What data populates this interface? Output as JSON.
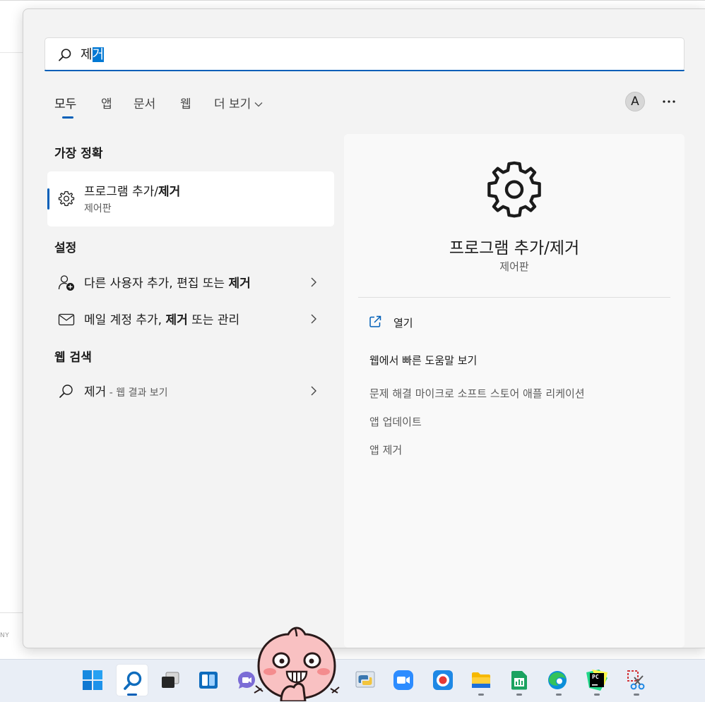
{
  "search": {
    "query_plain": "제",
    "query_selected": "거"
  },
  "tabs": [
    {
      "label": "모두",
      "active": true
    },
    {
      "label": "앱"
    },
    {
      "label": "문서"
    },
    {
      "label": "웹"
    },
    {
      "label": "더 보기"
    }
  ],
  "account": {
    "avatar_letter": "A"
  },
  "more_button_icon": "ellipsis-icon",
  "best_match": {
    "section_title": "가장 정확",
    "title_plain": "프로그램 추가/",
    "title_bold": "제거",
    "subtitle": "제어판",
    "icon": "gear-icon"
  },
  "settings": {
    "section_title": "설정",
    "items": [
      {
        "text_plain": "다른 사용자 추가, 편집 또는 ",
        "text_bold": "제거",
        "text_after": "",
        "icon": "add-user-icon"
      },
      {
        "text_plain": "메일 계정 추가, ",
        "text_bold": "제거",
        "text_after": " 또는 관리",
        "icon": "mail-icon"
      }
    ]
  },
  "web_search": {
    "section_title": "웹 검색",
    "query": "제거",
    "suffix": " - 웹 결과 보기",
    "icon": "search-icon"
  },
  "detail": {
    "title": "프로그램 추가/제거",
    "subtitle": "제어판",
    "open_label": "열기",
    "help_title": "웹에서 빠른 도움말 보기",
    "help_links": [
      "문제 해결 마이크로 소프트 스토어 애플 리케이션",
      "앱 업데이트",
      "앱 제거"
    ]
  },
  "background": {
    "corner_text": "NY"
  },
  "taskbar": {
    "apps": [
      {
        "name": "start",
        "icon": "windows-logo-icon"
      },
      {
        "name": "search",
        "icon": "search-icon",
        "active": true
      },
      {
        "name": "task-view",
        "icon": "task-view-icon"
      },
      {
        "name": "widgets",
        "icon": "widgets-icon"
      },
      {
        "name": "teams-chat",
        "icon": "teams-chat-icon"
      },
      {
        "name": "python",
        "icon": "python-icon"
      },
      {
        "name": "zoom",
        "icon": "zoom-icon"
      },
      {
        "name": "screen-recorder",
        "icon": "record-icon"
      },
      {
        "name": "file-explorer",
        "icon": "folder-icon"
      },
      {
        "name": "spreadsheet",
        "icon": "spreadsheet-icon"
      },
      {
        "name": "edge",
        "icon": "edge-icon"
      },
      {
        "name": "pycharm",
        "icon": "pycharm-icon"
      },
      {
        "name": "snipping-tool",
        "icon": "snipping-tool-icon"
      }
    ],
    "pycharm_label": "PC"
  },
  "colors": {
    "accent": "#005fb8",
    "panel_bg": "#f3f3f3",
    "taskbar_bg": "#e9eef6"
  }
}
